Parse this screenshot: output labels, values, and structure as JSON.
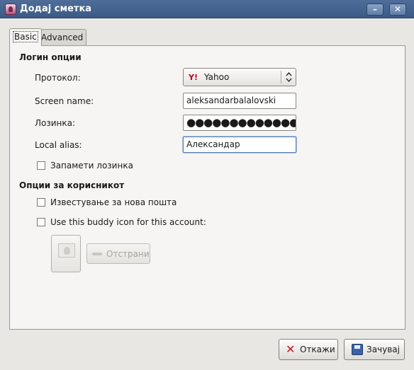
{
  "window": {
    "title": "Додај сметка",
    "minimize_glyph": "–",
    "close_glyph": "✕"
  },
  "tabs": {
    "basic": "Basic",
    "advanced": "Advanced"
  },
  "login": {
    "section_title": "Логин опции",
    "protocol_label": "Протокол:",
    "protocol_value": "Yahoo",
    "protocol_icon_glyph": "Y!",
    "screen_name_label": "Screen name:",
    "screen_name_value": "aleksandarbalalovski",
    "password_label": "Лозинка:",
    "password_value": "●●●●●●●●●●●●●●●",
    "alias_label": "Local alias:",
    "alias_value": "Александар",
    "remember_label": "Запамети лозинка",
    "remember_checked": false
  },
  "user_options": {
    "section_title": "Опции за корисникот",
    "new_mail_label": "Известување за нова пошта",
    "buddy_icon_label": "Use this buddy icon for this account:",
    "remove_label": "Отстрани"
  },
  "buttons": {
    "cancel": "Откажи",
    "save": "Зачувај"
  },
  "icons": {
    "app": "pidgin-icon",
    "protocol": "yahoo-icon",
    "chevron": "updown-chevron-icon",
    "cancel": "x-icon",
    "save": "floppy-disk-icon",
    "buddy": "image-placeholder-icon",
    "remove": "minus-icon"
  }
}
